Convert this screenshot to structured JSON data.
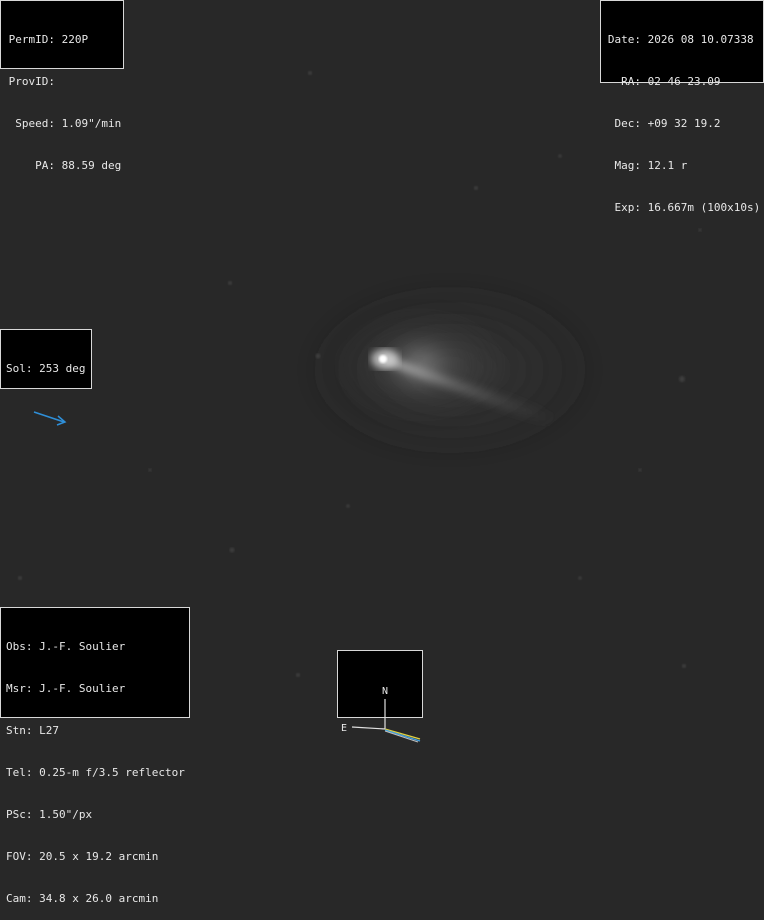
{
  "colors": {
    "sky": "#282828",
    "panel_bg": "#000000",
    "panel_text": "#e8e8e8",
    "sun_arrow": "#2f8fd8",
    "compass_axes": "#e0e0e0",
    "motion_vector": "#e0d040",
    "sun_vector": "#40a0e0"
  },
  "object_panel": {
    "permid_label": "PermID:",
    "permid_value": "220P",
    "provid_label": "ProvID:",
    "provid_value": "",
    "speed_label": "Speed:",
    "speed_value": "1.09\"/min",
    "pa_label": "PA:",
    "pa_value": "88.59 deg"
  },
  "ephemeris_panel": {
    "date_label": "Date:",
    "date_value": "2026 08 10.07338",
    "ra_label": "RA:",
    "ra_value": "02 46 23.09",
    "dec_label": "Dec:",
    "dec_value": "+09 32 19.2",
    "mag_label": "Mag:",
    "mag_value": "12.1 r",
    "exp_label": "Exp:",
    "exp_value": "16.667m (100x10s)"
  },
  "sol_panel": {
    "sol_label": "Sol:",
    "sol_value": "253 deg",
    "arrow_icon": "arrow-icon"
  },
  "observation_panel": {
    "obs_label": "Obs:",
    "obs_value": "J.-F. Soulier",
    "msr_label": "Msr:",
    "msr_value": "J.-F. Soulier",
    "stn_label": "Stn:",
    "stn_value": "L27",
    "tel_label": "Tel:",
    "tel_value": "0.25-m f/3.5 reflector",
    "psc_label": "PSc:",
    "psc_value": "1.50\"/px",
    "fov_label": "FOV:",
    "fov_value": "20.5 x 19.2 arcmin",
    "cam_label": "Cam:",
    "cam_value": "34.8 x 26.0 arcmin"
  },
  "compass": {
    "north_label": "N",
    "east_label": "E"
  }
}
